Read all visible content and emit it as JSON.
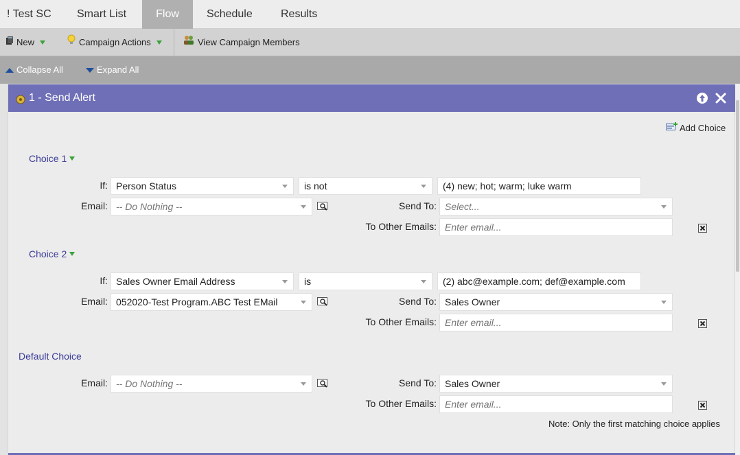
{
  "tabs": [
    "! Test SC",
    "Smart List",
    "Flow",
    "Schedule",
    "Results"
  ],
  "toolbar": {
    "new_label": "New",
    "campaign_actions_label": "Campaign Actions",
    "view_members_label": "View Campaign Members"
  },
  "subbar": {
    "collapse_label": "Collapse All",
    "expand_label": "Expand All"
  },
  "panel": {
    "title": "1 - Send Alert",
    "add_choice_label": "Add Choice",
    "if_label": "If:",
    "email_label": "Email:",
    "send_to_label": "Send To:",
    "other_emails_label": "To Other Emails:",
    "choices": [
      {
        "label": "Choice 1",
        "attribute": "Person Status",
        "operator": "is not",
        "values": "(4) new; hot; warm; luke warm",
        "email": "-- Do Nothing --",
        "send_to": "Select...",
        "other_emails_placeholder": "Enter email..."
      },
      {
        "label": "Choice 2",
        "attribute": "Sales Owner Email Address",
        "operator": "is",
        "values": "(2) abc@example.com; def@example.com",
        "email": "052020-Test Program.ABC Test EMail",
        "send_to": "Sales Owner",
        "other_emails_placeholder": "Enter email..."
      }
    ],
    "default_choice": {
      "label": "Default Choice",
      "email": "-- Do Nothing --",
      "send_to": "Sales Owner",
      "other_emails_placeholder": "Enter email..."
    },
    "note": "Note: Only the first matching choice applies"
  },
  "colors": {
    "panel_header": "#6f6fb8",
    "active_tab": "#b0b0b0",
    "choice_label": "#3b3b9a"
  }
}
